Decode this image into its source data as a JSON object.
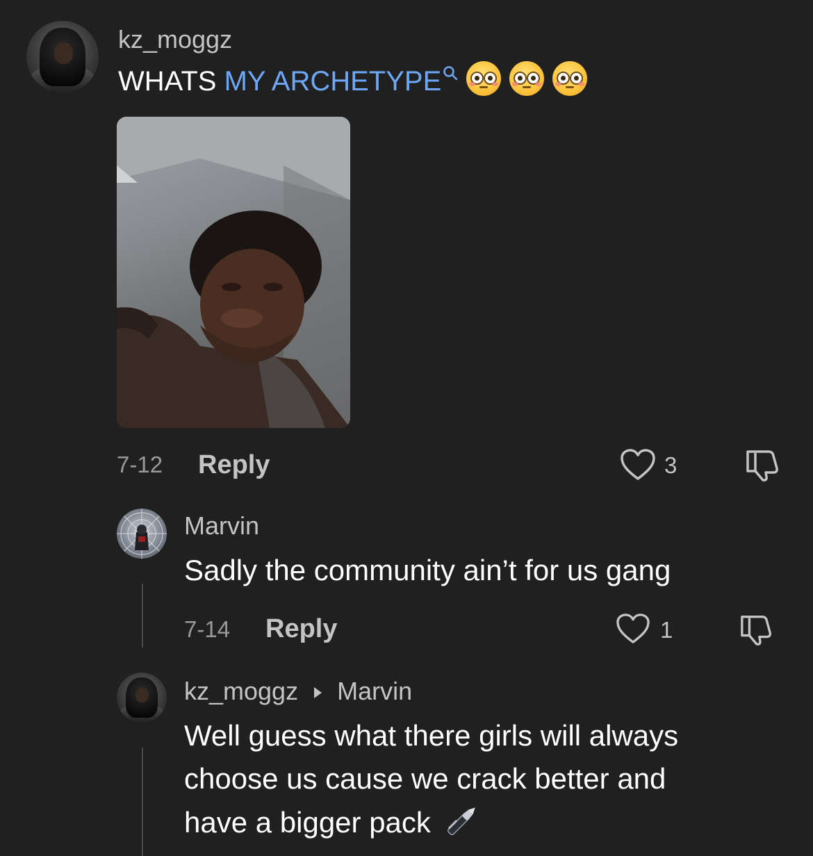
{
  "comments": [
    {
      "username": "kz_moggz",
      "text_plain": "WHATS ",
      "text_link": "MY ARCHETYPE",
      "emojis": [
        "flushed-face",
        "flushed-face",
        "flushed-face"
      ],
      "date": "7-12",
      "reply_label": "Reply",
      "likes": "3"
    },
    {
      "username": "Marvin",
      "text": "Sadly the community ain’t for us gang",
      "date": "7-14",
      "reply_label": "Reply",
      "likes": "1"
    },
    {
      "username": "kz_moggz",
      "reply_to": "Marvin",
      "text_lines": [
        "Well guess what there girls will always",
        "choose us cause we crack better and",
        "have a bigger pack"
      ],
      "emoji": "pen"
    }
  ],
  "colors": {
    "background": "#202020",
    "link": "#6ea7f5",
    "username": "#c4c4c4",
    "meta": "#9a9a9a"
  }
}
